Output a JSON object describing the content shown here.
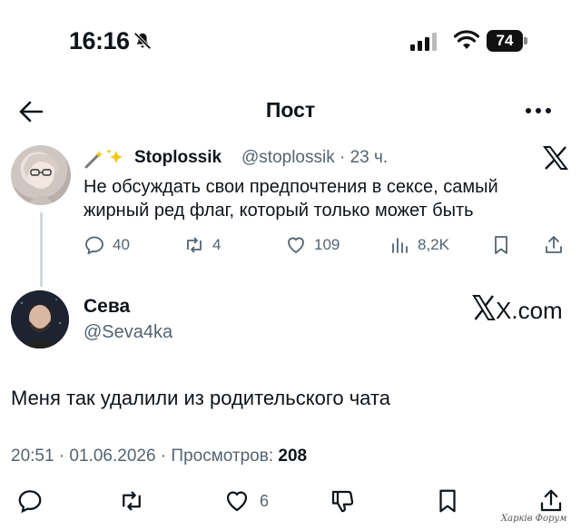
{
  "status_bar": {
    "time": "16:16",
    "battery": "74"
  },
  "header": {
    "title": "Пост"
  },
  "quoted_tweet": {
    "name": "Stoplossik",
    "handle": "@stoplossik",
    "time": "· 23 ч.",
    "text": "Не обсуждать свои предпочтения в сексе, самый жирный ред флаг, который только может быть",
    "replies": "40",
    "retweets": "4",
    "likes": "109",
    "views": "8,2K"
  },
  "main_tweet": {
    "name": "Сева",
    "handle": "@Seva4ka",
    "brand": "X.com",
    "text": "Меня так удалили из родительского чата",
    "meta_prefix": "20:51 · 01.06.2026 · Просмотров: ",
    "views": "208",
    "likes": "6"
  },
  "watermark": "Харків Форум",
  "icons": [
    "bell-off-icon",
    "signal-icon",
    "wifi-icon",
    "battery-icon",
    "back-arrow-icon",
    "more-icon",
    "x-logo-icon",
    "reply-icon",
    "retweet-icon",
    "like-icon",
    "views-icon",
    "bookmark-icon",
    "share-icon",
    "dislike-icon"
  ],
  "colors": {
    "text": "#0f1419",
    "muted": "#536471",
    "thread_line": "#cfd9de"
  }
}
